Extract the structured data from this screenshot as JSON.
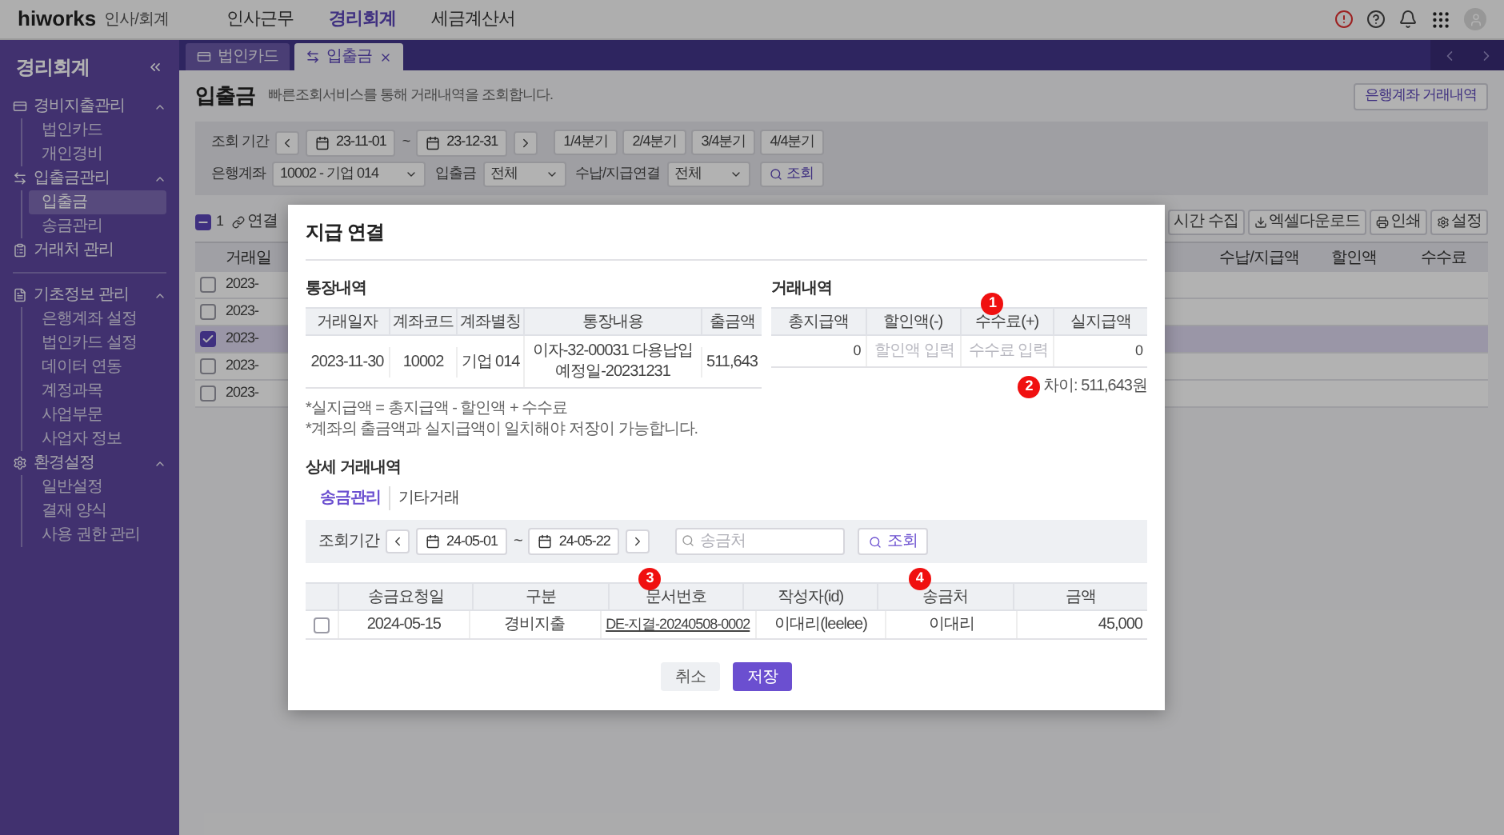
{
  "top_bar": {
    "logo": "hiworks",
    "product": "인사/회계",
    "nav": [
      {
        "label": "인사근무",
        "selected": false
      },
      {
        "label": "경리회계",
        "selected": true
      },
      {
        "label": "세금계산서",
        "selected": false
      }
    ]
  },
  "sidebar": {
    "title": "경리회계",
    "blocks": [
      [
        {
          "kind": "section",
          "label": "경비지출관리",
          "expanded": true,
          "children": [
            {
              "label": "법인카드",
              "selected": false
            },
            {
              "label": "개인경비",
              "selected": false
            }
          ]
        },
        {
          "kind": "section",
          "label": "입출금관리",
          "expanded": true,
          "children": [
            {
              "label": "입출금",
              "selected": true
            },
            {
              "label": "송금관리",
              "selected": false
            }
          ]
        },
        {
          "kind": "link",
          "label": "거래처 관리"
        }
      ],
      [
        {
          "kind": "section",
          "label": "기초정보 관리",
          "expanded": true,
          "children": [
            {
              "label": "은행계좌 설정",
              "selected": false
            },
            {
              "label": "법인카드 설정",
              "selected": false
            },
            {
              "label": "데이터 연동",
              "selected": false
            },
            {
              "label": "계정과목",
              "selected": false
            },
            {
              "label": "사업부문",
              "selected": false
            },
            {
              "label": "사업자 정보",
              "selected": false
            }
          ]
        },
        {
          "kind": "section",
          "label": "환경설정",
          "expanded": true,
          "children": [
            {
              "label": "일반설정",
              "selected": false
            },
            {
              "label": "결재 양식",
              "selected": false
            },
            {
              "label": "사용 권한 관리",
              "selected": false
            }
          ]
        }
      ]
    ]
  },
  "tabs": [
    {
      "label": "법인카드",
      "selected": false,
      "closable": false
    },
    {
      "label": "입출금",
      "selected": true,
      "closable": true
    }
  ],
  "page": {
    "title": "입출금",
    "description": "빠른조회서비스를 통해 거래내역을 조회합니다.",
    "header_button": "은행계좌 거래내역"
  },
  "filters": {
    "period_label": "조회 기간",
    "start": "23-11-01",
    "separator": "~",
    "end": "23-12-31",
    "quarters": [
      "1/4분기",
      "2/4분기",
      "3/4분기",
      "4/4분기"
    ],
    "selects": [
      {
        "label": "은행계좌",
        "value": "10002 - 기업 014"
      },
      {
        "label": "입출금",
        "value": "전체"
      },
      {
        "label": "수납/지급연결",
        "value": "전체"
      }
    ],
    "search_button": "조회"
  },
  "list_toolbar": {
    "select_all_partial": true,
    "selected_count": "1",
    "link_button": "연결",
    "buttons": [
      {
        "kind": "plain",
        "label": "시간 수집"
      },
      {
        "kind": "download",
        "label": "엑셀다운로드"
      },
      {
        "kind": "print",
        "label": "인쇄"
      },
      {
        "kind": "settings",
        "label": "설정"
      }
    ]
  },
  "list_table": {
    "left_header": "거래일",
    "right_columns": [
      "수납/지급액",
      "할인액",
      "수수료"
    ],
    "rows": [
      {
        "date": "2023-",
        "checked": false,
        "selected": false
      },
      {
        "date": "2023-",
        "checked": false,
        "selected": false
      },
      {
        "date": "2023-",
        "checked": true,
        "selected": true
      },
      {
        "date": "2023-",
        "checked": false,
        "selected": false
      },
      {
        "date": "2023-",
        "checked": false,
        "selected": false
      }
    ]
  },
  "dialog": {
    "title": "지급 연결",
    "bank_statement": {
      "title": "통장내역",
      "columns": [
        "거래일자",
        "계좌코드",
        "계좌별칭",
        "통장내용",
        "출금액"
      ],
      "row": [
        "2023-11-30",
        "10002",
        "기업 014",
        "이자-32-00031 다용납입예정일-20231231",
        "511,643"
      ],
      "notes": [
        "*실지급액 = 총지급액 - 할인액 + 수수료",
        "*계좌의 출금액과 실지급액이 일치해야 저장이 가능합니다."
      ]
    },
    "transaction": {
      "title": "거래내역",
      "columns": [
        {
          "label": "총지급액"
        },
        {
          "label": "할인액(-)"
        },
        {
          "label": "수수료(+)",
          "marker": "1"
        },
        {
          "label": "실지급액"
        }
      ],
      "cells": [
        {
          "kind": "text",
          "value": "0"
        },
        {
          "kind": "input",
          "placeholder": "할인액 입력"
        },
        {
          "kind": "input",
          "placeholder": "수수료 입력"
        },
        {
          "kind": "text",
          "value": "0"
        }
      ],
      "difference": {
        "marker": "2",
        "text": "차이: 511,643원"
      }
    },
    "detail": {
      "title": "상세 거래내역",
      "tabs": [
        {
          "label": "송금관리",
          "selected": true
        },
        {
          "label": "기타거래",
          "selected": false
        }
      ],
      "filter": {
        "label": "조회기간",
        "start": "24-05-01",
        "separator": "~",
        "end": "24-05-22",
        "search_placeholder": "송금처",
        "search_button": "조회"
      },
      "columns": [
        {
          "label": "송금요청일"
        },
        {
          "label": "구분"
        },
        {
          "label": "문서번호",
          "marker": "3"
        },
        {
          "label": "작성자(id)"
        },
        {
          "label": "송금처",
          "marker": "4"
        },
        {
          "label": "금액"
        }
      ],
      "rows": [
        {
          "checked": false,
          "cells": [
            {
              "kind": "text",
              "value": "2024-05-15"
            },
            {
              "kind": "text",
              "value": "경비지출"
            },
            {
              "kind": "link",
              "value": "DE-지결-20240508-0002"
            },
            {
              "kind": "text",
              "value": "이대리(leelee)"
            },
            {
              "kind": "text",
              "value": "이대리"
            },
            {
              "kind": "amount",
              "value": "45,000"
            }
          ]
        }
      ]
    },
    "buttons": [
      {
        "kind": "secondary",
        "label": "취소"
      },
      {
        "kind": "primary",
        "label": "저장"
      }
    ]
  }
}
